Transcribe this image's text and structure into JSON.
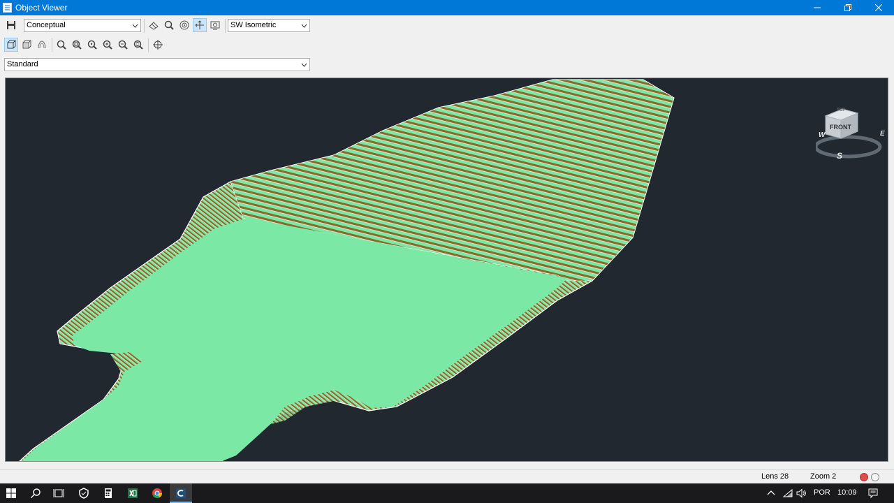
{
  "window": {
    "title": "Object Viewer"
  },
  "toolbar": {
    "visual_style": {
      "value": "Conceptual"
    },
    "view_preset": {
      "value": "SW Isometric"
    },
    "view_style": {
      "value": "Standard"
    }
  },
  "viewcube": {
    "face_front": "FRONT",
    "face_top": "TOP",
    "compass_w": "W",
    "compass_e": "E",
    "compass_s": "S"
  },
  "status": {
    "lens": "Lens 28",
    "zoom": "Zoom 2"
  },
  "taskbar": {
    "language": "POR",
    "time": "10:09"
  },
  "colors": {
    "titlebar": "#0078d7",
    "viewport_bg": "#212830",
    "surface_fill": "#7ce8a6",
    "contour_dark": "#8a6a2a",
    "taskbar_bg": "#1a1a1c"
  },
  "icons": [
    "save-icon",
    "visual-style-toggle-icon",
    "zoom-icon",
    "orbit-icon",
    "pan-icon",
    "steering-icon",
    "front-view-icon",
    "top-view-icon",
    "hidden-icon",
    "zoom-realtime-icon",
    "zoom-window-icon",
    "zoom-center-icon",
    "zoom-in-icon",
    "zoom-out-icon",
    "zoom-extents-icon",
    "pan-target-icon"
  ]
}
